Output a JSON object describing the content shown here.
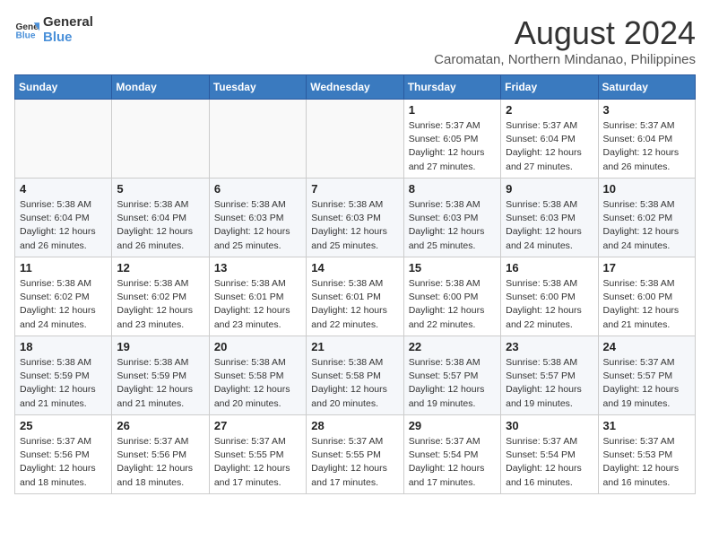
{
  "header": {
    "logo_line1": "General",
    "logo_line2": "Blue",
    "month_year": "August 2024",
    "location": "Caromatan, Northern Mindanao, Philippines"
  },
  "weekdays": [
    "Sunday",
    "Monday",
    "Tuesday",
    "Wednesday",
    "Thursday",
    "Friday",
    "Saturday"
  ],
  "weeks": [
    [
      {
        "day": "",
        "info": ""
      },
      {
        "day": "",
        "info": ""
      },
      {
        "day": "",
        "info": ""
      },
      {
        "day": "",
        "info": ""
      },
      {
        "day": "1",
        "info": "Sunrise: 5:37 AM\nSunset: 6:05 PM\nDaylight: 12 hours\nand 27 minutes."
      },
      {
        "day": "2",
        "info": "Sunrise: 5:37 AM\nSunset: 6:04 PM\nDaylight: 12 hours\nand 27 minutes."
      },
      {
        "day": "3",
        "info": "Sunrise: 5:37 AM\nSunset: 6:04 PM\nDaylight: 12 hours\nand 26 minutes."
      }
    ],
    [
      {
        "day": "4",
        "info": "Sunrise: 5:38 AM\nSunset: 6:04 PM\nDaylight: 12 hours\nand 26 minutes."
      },
      {
        "day": "5",
        "info": "Sunrise: 5:38 AM\nSunset: 6:04 PM\nDaylight: 12 hours\nand 26 minutes."
      },
      {
        "day": "6",
        "info": "Sunrise: 5:38 AM\nSunset: 6:03 PM\nDaylight: 12 hours\nand 25 minutes."
      },
      {
        "day": "7",
        "info": "Sunrise: 5:38 AM\nSunset: 6:03 PM\nDaylight: 12 hours\nand 25 minutes."
      },
      {
        "day": "8",
        "info": "Sunrise: 5:38 AM\nSunset: 6:03 PM\nDaylight: 12 hours\nand 25 minutes."
      },
      {
        "day": "9",
        "info": "Sunrise: 5:38 AM\nSunset: 6:03 PM\nDaylight: 12 hours\nand 24 minutes."
      },
      {
        "day": "10",
        "info": "Sunrise: 5:38 AM\nSunset: 6:02 PM\nDaylight: 12 hours\nand 24 minutes."
      }
    ],
    [
      {
        "day": "11",
        "info": "Sunrise: 5:38 AM\nSunset: 6:02 PM\nDaylight: 12 hours\nand 24 minutes."
      },
      {
        "day": "12",
        "info": "Sunrise: 5:38 AM\nSunset: 6:02 PM\nDaylight: 12 hours\nand 23 minutes."
      },
      {
        "day": "13",
        "info": "Sunrise: 5:38 AM\nSunset: 6:01 PM\nDaylight: 12 hours\nand 23 minutes."
      },
      {
        "day": "14",
        "info": "Sunrise: 5:38 AM\nSunset: 6:01 PM\nDaylight: 12 hours\nand 22 minutes."
      },
      {
        "day": "15",
        "info": "Sunrise: 5:38 AM\nSunset: 6:00 PM\nDaylight: 12 hours\nand 22 minutes."
      },
      {
        "day": "16",
        "info": "Sunrise: 5:38 AM\nSunset: 6:00 PM\nDaylight: 12 hours\nand 22 minutes."
      },
      {
        "day": "17",
        "info": "Sunrise: 5:38 AM\nSunset: 6:00 PM\nDaylight: 12 hours\nand 21 minutes."
      }
    ],
    [
      {
        "day": "18",
        "info": "Sunrise: 5:38 AM\nSunset: 5:59 PM\nDaylight: 12 hours\nand 21 minutes."
      },
      {
        "day": "19",
        "info": "Sunrise: 5:38 AM\nSunset: 5:59 PM\nDaylight: 12 hours\nand 21 minutes."
      },
      {
        "day": "20",
        "info": "Sunrise: 5:38 AM\nSunset: 5:58 PM\nDaylight: 12 hours\nand 20 minutes."
      },
      {
        "day": "21",
        "info": "Sunrise: 5:38 AM\nSunset: 5:58 PM\nDaylight: 12 hours\nand 20 minutes."
      },
      {
        "day": "22",
        "info": "Sunrise: 5:38 AM\nSunset: 5:57 PM\nDaylight: 12 hours\nand 19 minutes."
      },
      {
        "day": "23",
        "info": "Sunrise: 5:38 AM\nSunset: 5:57 PM\nDaylight: 12 hours\nand 19 minutes."
      },
      {
        "day": "24",
        "info": "Sunrise: 5:37 AM\nSunset: 5:57 PM\nDaylight: 12 hours\nand 19 minutes."
      }
    ],
    [
      {
        "day": "25",
        "info": "Sunrise: 5:37 AM\nSunset: 5:56 PM\nDaylight: 12 hours\nand 18 minutes."
      },
      {
        "day": "26",
        "info": "Sunrise: 5:37 AM\nSunset: 5:56 PM\nDaylight: 12 hours\nand 18 minutes."
      },
      {
        "day": "27",
        "info": "Sunrise: 5:37 AM\nSunset: 5:55 PM\nDaylight: 12 hours\nand 17 minutes."
      },
      {
        "day": "28",
        "info": "Sunrise: 5:37 AM\nSunset: 5:55 PM\nDaylight: 12 hours\nand 17 minutes."
      },
      {
        "day": "29",
        "info": "Sunrise: 5:37 AM\nSunset: 5:54 PM\nDaylight: 12 hours\nand 17 minutes."
      },
      {
        "day": "30",
        "info": "Sunrise: 5:37 AM\nSunset: 5:54 PM\nDaylight: 12 hours\nand 16 minutes."
      },
      {
        "day": "31",
        "info": "Sunrise: 5:37 AM\nSunset: 5:53 PM\nDaylight: 12 hours\nand 16 minutes."
      }
    ]
  ]
}
